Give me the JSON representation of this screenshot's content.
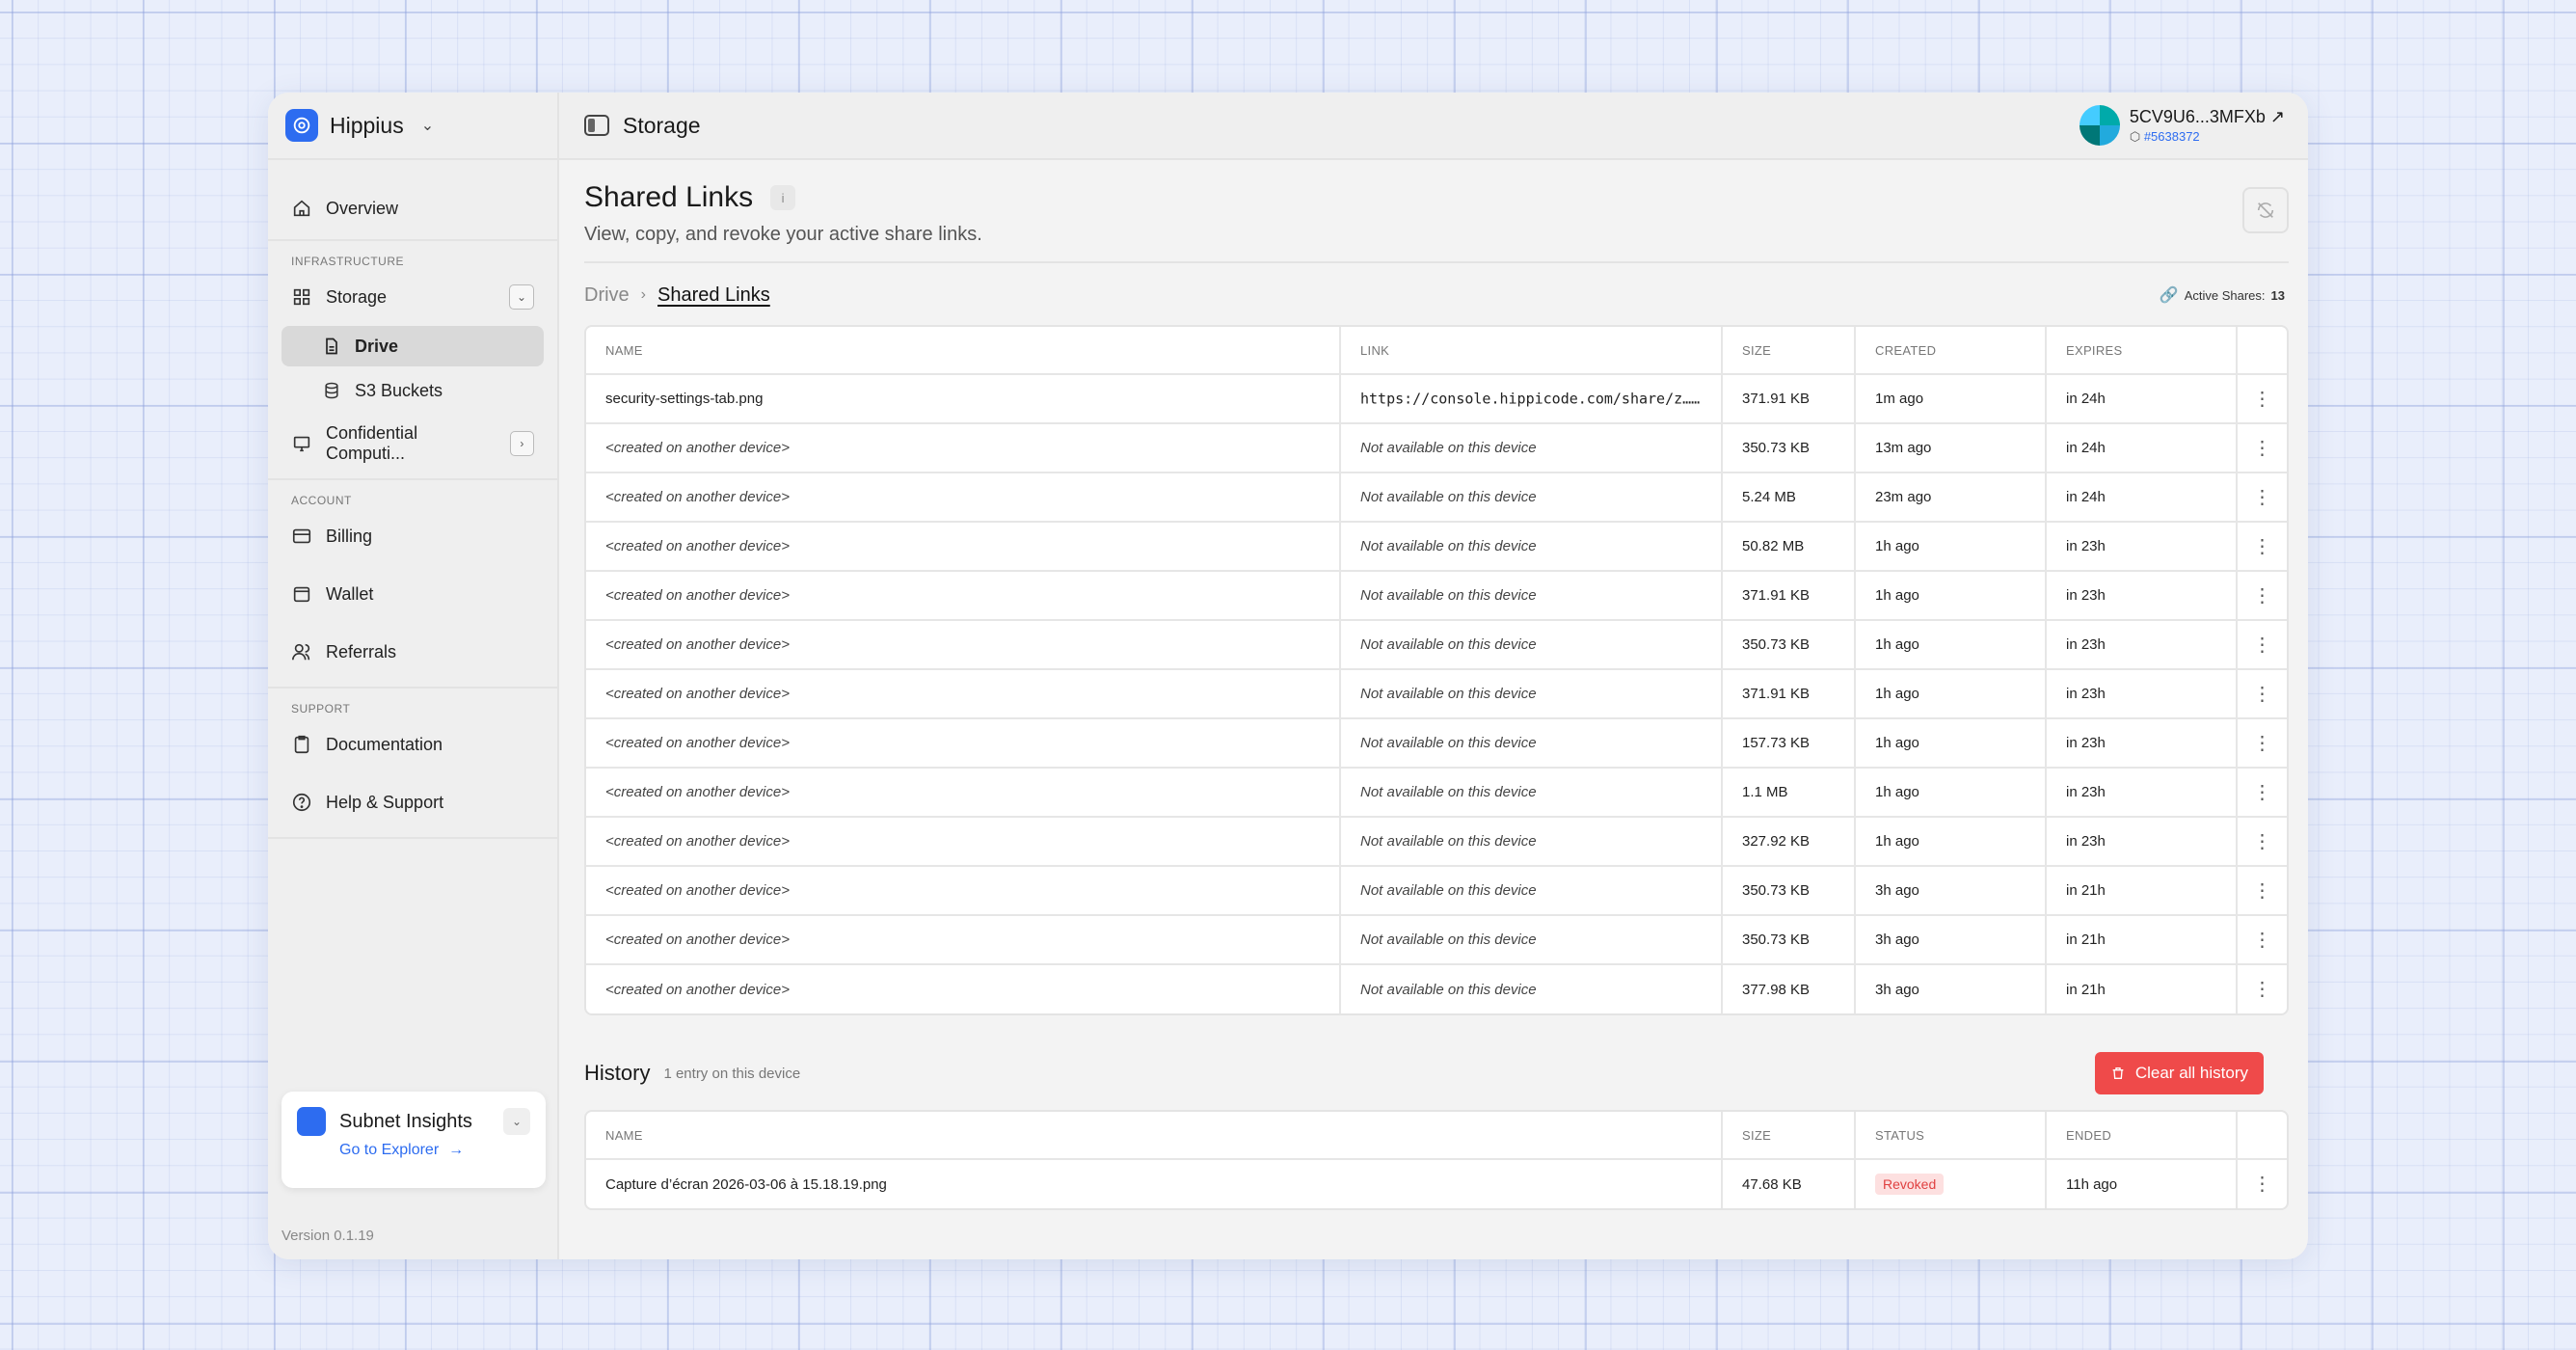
{
  "brand": {
    "name": "Hippius"
  },
  "sidebar": {
    "overview": "Overview",
    "section_infrastructure": "INFRASTRUCTURE",
    "storage": "Storage",
    "drive": "Drive",
    "s3": "S3 Buckets",
    "confidential": "Confidential Computi...",
    "section_account": "ACCOUNT",
    "billing": "Billing",
    "wallet": "Wallet",
    "referrals": "Referrals",
    "section_support": "SUPPORT",
    "documentation": "Documentation",
    "help": "Help & Support"
  },
  "insights": {
    "title": "Subnet Insights",
    "link": "Go to Explorer"
  },
  "version": "Version 0.1.19",
  "topbar": {
    "title": "Storage",
    "account_name": "5CV9U6...3MFXb",
    "account_block": "#5638372"
  },
  "page": {
    "title": "Shared Links",
    "subtitle": "View, copy, and revoke your active share links."
  },
  "breadcrumb": {
    "root": "Drive",
    "current": "Shared Links"
  },
  "active_shares": {
    "label": "Active Shares:",
    "count": "13"
  },
  "shares_table": {
    "headers": {
      "name": "NAME",
      "link": "LINK",
      "size": "SIZE",
      "created": "CREATED",
      "expires": "EXPIRES"
    },
    "rows": [
      {
        "name": "security-settings-tab.png",
        "link": "https://console.hippicode.com/share/z…",
        "size": "371.91 KB",
        "created": "1m ago",
        "expires": "in 24h",
        "other": false
      },
      {
        "name": "<created on another device>",
        "link": "Not available on this device",
        "size": "350.73 KB",
        "created": "13m ago",
        "expires": "in 24h",
        "other": true
      },
      {
        "name": "<created on another device>",
        "link": "Not available on this device",
        "size": "5.24 MB",
        "created": "23m ago",
        "expires": "in 24h",
        "other": true
      },
      {
        "name": "<created on another device>",
        "link": "Not available on this device",
        "size": "50.82 MB",
        "created": "1h ago",
        "expires": "in 23h",
        "other": true
      },
      {
        "name": "<created on another device>",
        "link": "Not available on this device",
        "size": "371.91 KB",
        "created": "1h ago",
        "expires": "in 23h",
        "other": true
      },
      {
        "name": "<created on another device>",
        "link": "Not available on this device",
        "size": "350.73 KB",
        "created": "1h ago",
        "expires": "in 23h",
        "other": true
      },
      {
        "name": "<created on another device>",
        "link": "Not available on this device",
        "size": "371.91 KB",
        "created": "1h ago",
        "expires": "in 23h",
        "other": true
      },
      {
        "name": "<created on another device>",
        "link": "Not available on this device",
        "size": "157.73 KB",
        "created": "1h ago",
        "expires": "in 23h",
        "other": true
      },
      {
        "name": "<created on another device>",
        "link": "Not available on this device",
        "size": "1.1 MB",
        "created": "1h ago",
        "expires": "in 23h",
        "other": true
      },
      {
        "name": "<created on another device>",
        "link": "Not available on this device",
        "size": "327.92 KB",
        "created": "1h ago",
        "expires": "in 23h",
        "other": true
      },
      {
        "name": "<created on another device>",
        "link": "Not available on this device",
        "size": "350.73 KB",
        "created": "3h ago",
        "expires": "in 21h",
        "other": true
      },
      {
        "name": "<created on another device>",
        "link": "Not available on this device",
        "size": "350.73 KB",
        "created": "3h ago",
        "expires": "in 21h",
        "other": true
      },
      {
        "name": "<created on another device>",
        "link": "Not available on this device",
        "size": "377.98 KB",
        "created": "3h ago",
        "expires": "in 21h",
        "other": true
      }
    ]
  },
  "history": {
    "title": "History",
    "count": "1 entry on this device",
    "clear_label": "Clear all history",
    "headers": {
      "name": "NAME",
      "size": "SIZE",
      "status": "STATUS",
      "ended": "ENDED"
    },
    "rows": [
      {
        "name": "Capture d’écran 2026-03-06 à 15.18.19.png",
        "size": "47.68 KB",
        "status": "Revoked",
        "ended": "11h ago"
      }
    ]
  },
  "colors": {
    "accent": "#2d6cf0",
    "danger": "#ef4a4a"
  }
}
